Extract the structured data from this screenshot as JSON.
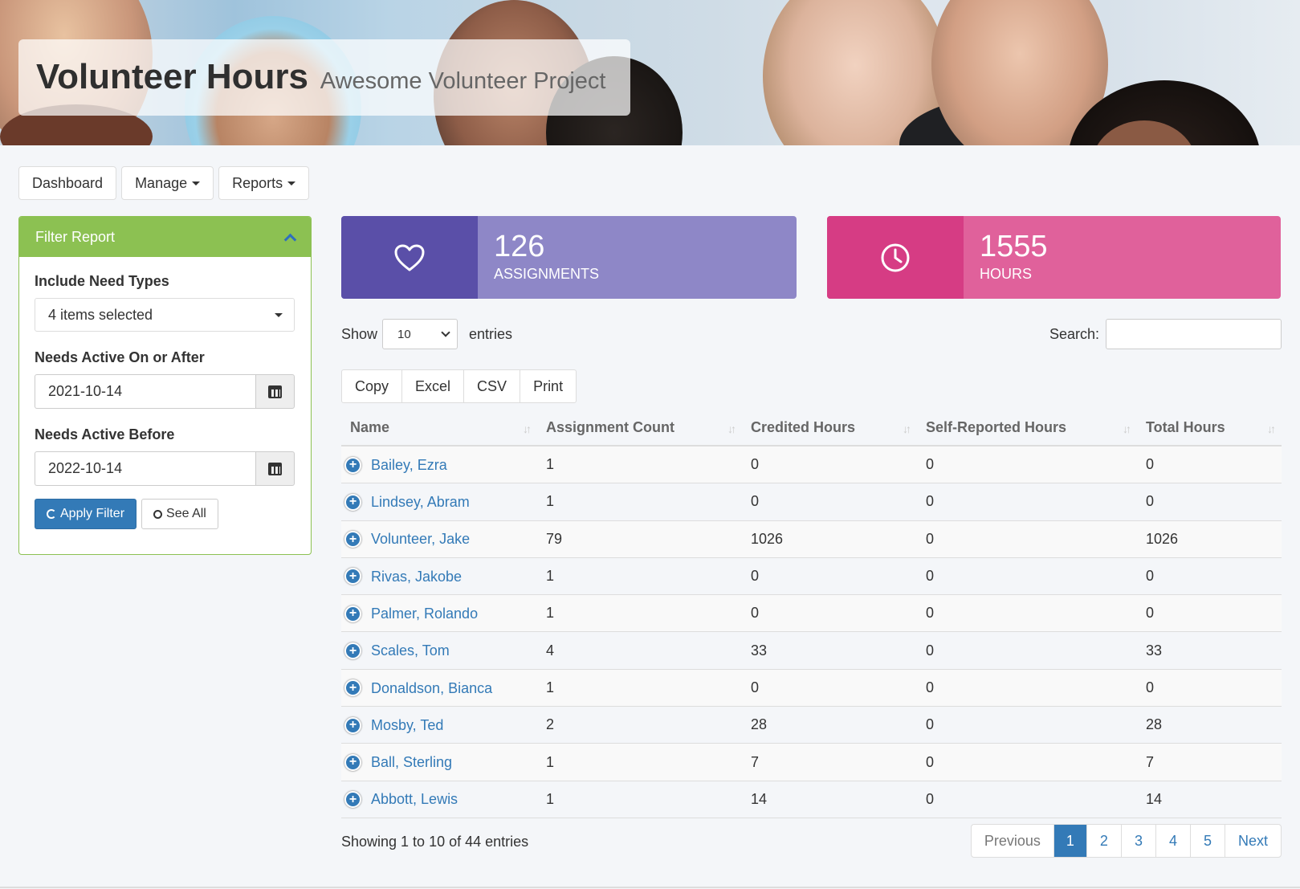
{
  "banner": {
    "title": "Volunteer Hours",
    "subtitle": "Awesome Volunteer Project"
  },
  "nav": {
    "dashboard": "Dashboard",
    "manage": "Manage",
    "reports": "Reports"
  },
  "filter": {
    "heading": "Filter Report",
    "need_types_label": "Include Need Types",
    "need_types_value": "4 items selected",
    "active_after_label": "Needs Active On or After",
    "active_after_value": "2021-10-14",
    "active_before_label": "Needs Active Before",
    "active_before_value": "2022-10-14",
    "apply_label": "Apply Filter",
    "see_all_label": "See All"
  },
  "stats": {
    "assignments_value": "126",
    "assignments_label": "ASSIGNMENTS",
    "hours_value": "1555",
    "hours_label": "HOURS"
  },
  "colors": {
    "filter_green": "#8cc152",
    "assignments_dark": "#5a4fa8",
    "assignments_light": "#8e87c7",
    "hours_dark": "#d63c84",
    "hours_light": "#e0619b",
    "link_blue": "#337ab7"
  },
  "table_controls": {
    "show_label": "Show",
    "length_value": "10",
    "entries_label": "entries",
    "search_label": "Search:",
    "search_value": "",
    "export_buttons": [
      "Copy",
      "Excel",
      "CSV",
      "Print"
    ]
  },
  "table": {
    "columns": [
      "Name",
      "Assignment Count",
      "Credited Hours",
      "Self-Reported Hours",
      "Total Hours"
    ],
    "rows": [
      {
        "name": "Bailey, Ezra",
        "count": "1",
        "credited": "0",
        "self": "0",
        "total": "0"
      },
      {
        "name": "Lindsey, Abram",
        "count": "1",
        "credited": "0",
        "self": "0",
        "total": "0"
      },
      {
        "name": "Volunteer, Jake",
        "count": "79",
        "credited": "1026",
        "self": "0",
        "total": "1026"
      },
      {
        "name": "Rivas, Jakobe",
        "count": "1",
        "credited": "0",
        "self": "0",
        "total": "0"
      },
      {
        "name": "Palmer, Rolando",
        "count": "1",
        "credited": "0",
        "self": "0",
        "total": "0"
      },
      {
        "name": "Scales, Tom",
        "count": "4",
        "credited": "33",
        "self": "0",
        "total": "33"
      },
      {
        "name": "Donaldson, Bianca",
        "count": "1",
        "credited": "0",
        "self": "0",
        "total": "0"
      },
      {
        "name": "Mosby, Ted",
        "count": "2",
        "credited": "28",
        "self": "0",
        "total": "28"
      },
      {
        "name": "Ball, Sterling",
        "count": "1",
        "credited": "7",
        "self": "0",
        "total": "7"
      },
      {
        "name": "Abbott, Lewis",
        "count": "1",
        "credited": "14",
        "self": "0",
        "total": "14"
      }
    ]
  },
  "footer": {
    "info": "Showing 1 to 10 of 44 entries",
    "previous": "Previous",
    "pages": [
      "1",
      "2",
      "3",
      "4",
      "5"
    ],
    "next": "Next",
    "active_page": "1"
  }
}
